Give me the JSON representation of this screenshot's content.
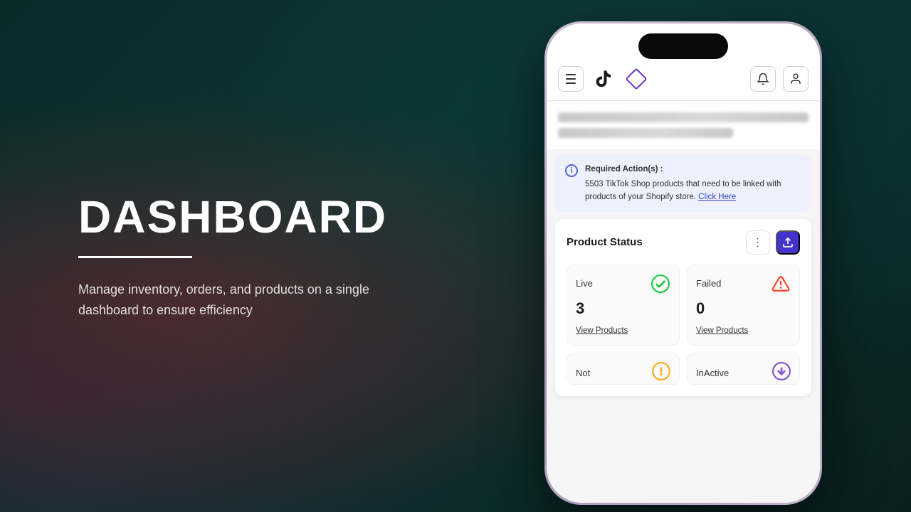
{
  "page": {
    "title": "DASHBOARD",
    "divider": true,
    "subtitle": "Manage inventory, orders, and products on a single dashboard to ensure efficiency"
  },
  "phone": {
    "header": {
      "menu_label": "Menu",
      "tiktok_logo": "TikTok",
      "app_logo": "App",
      "bell_label": "Notifications",
      "user_label": "User"
    },
    "welcome": {
      "line1": "Welcome text blurred",
      "line2": "Welcome text blurred 2"
    },
    "required_action": {
      "icon": "i",
      "title": "Required Action(s) :",
      "body": "5503 TikTok Shop products that need to be linked with products of your Shopify store.",
      "link_text": "Click Here"
    },
    "product_status": {
      "title": "Product Status",
      "menu_icon": "⋮",
      "upload_icon": "↑",
      "items": [
        {
          "label": "Live",
          "count": "3",
          "link": "View Products",
          "icon_type": "check-green",
          "status": "live"
        },
        {
          "label": "Failed",
          "count": "0",
          "link": "View Products",
          "icon_type": "warning-orange",
          "status": "failed"
        },
        {
          "label": "Not",
          "count": "",
          "link": "",
          "icon_type": "warning-yellow",
          "status": "not"
        },
        {
          "label": "InActive",
          "count": "",
          "link": "",
          "icon_type": "arrow-purple",
          "status": "inactive"
        }
      ]
    }
  },
  "colors": {
    "bg_dark": "#0d3535",
    "accent_purple": "#4433cc",
    "accent_diamond": "#6633cc",
    "check_green": "#22cc44",
    "warning_red": "#ff4422",
    "warning_yellow": "#ffaa22",
    "info_blue": "#5566cc",
    "link_blue": "#3344cc"
  }
}
